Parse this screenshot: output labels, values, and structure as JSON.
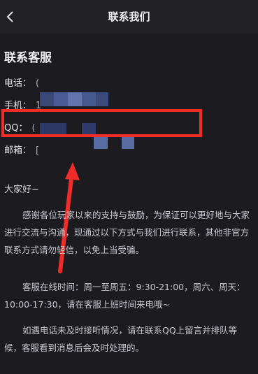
{
  "nav": {
    "title": "联系我们",
    "back_icon": "chevron-left-icon"
  },
  "section": {
    "title": "联系客服"
  },
  "contacts": [
    {
      "label": "电话：",
      "value": "("
    },
    {
      "label": "手机：",
      "value": "1"
    },
    {
      "label": "QQ：",
      "value": "("
    },
    {
      "label": "邮箱：",
      "value": "["
    }
  ],
  "greeting": "大家好~",
  "paragraphs": [
    "感谢各位玩家以来的支持与鼓励，为保证可以更好地与大家进行交流与沟通，现通过以下方式与我们进行联系，其他非官方联系方式请勿轻信，以免上当受骗。",
    "客服在线时间：周一至周五：9:30-21:00，周六、周天：10:00-17:30，请在客服上班时间来电哦~",
    "如遇电话未及时接听情况，请在联系QQ上留言并排队等候，客服看到消息后会及时处理的。"
  ],
  "colors": {
    "highlight": "#ee2d2a",
    "background": "#1c1c20"
  }
}
